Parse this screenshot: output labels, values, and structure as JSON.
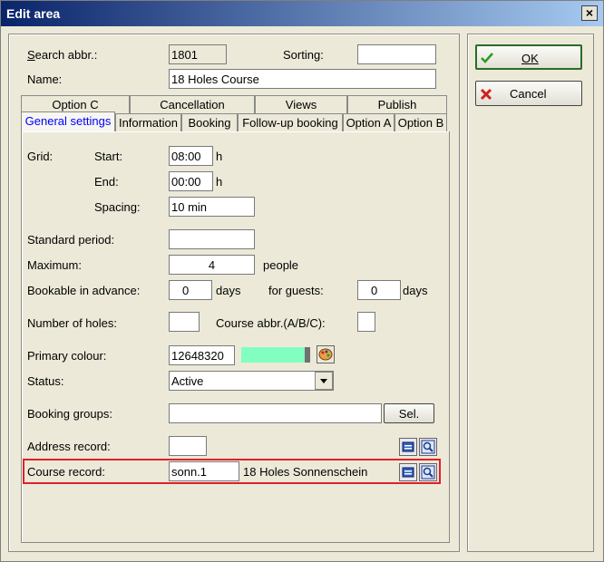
{
  "window": {
    "title": "Edit area",
    "close_glyph": "×"
  },
  "fields": {
    "search_abbr": {
      "label": "Search abbr.:",
      "value": "1801"
    },
    "sorting": {
      "label": "Sorting:",
      "value": ""
    },
    "name": {
      "label": "Name:",
      "value": "18 Holes Course"
    }
  },
  "tabs_top": [
    "Option C",
    "Cancellation",
    "Views",
    "Publish"
  ],
  "tabs_bottom": [
    "General settings",
    "Information",
    "Booking",
    "Follow-up booking",
    "Option A",
    "Option B"
  ],
  "grid": {
    "label": "Grid:",
    "start_label": "Start:",
    "start_value": "08:00",
    "start_unit": "h",
    "end_label": "End:",
    "end_value": "00:00",
    "end_unit": "h",
    "spacing_label": "Spacing:",
    "spacing_value": "10 min"
  },
  "standard_period": {
    "label": "Standard period:",
    "value": ""
  },
  "maximum": {
    "label": "Maximum:",
    "value": "4",
    "unit": "people"
  },
  "bookable": {
    "label": "Bookable in advance:",
    "value": "0",
    "unit": "days",
    "guests_label": "for guests:",
    "guests_value": "0",
    "guests_unit": "days"
  },
  "holes": {
    "label": "Number of holes:",
    "value": "",
    "course_abbr_label": "Course abbr.(A/B/C):",
    "course_abbr_value": ""
  },
  "primary_colour": {
    "label": "Primary colour:",
    "value": "12648320",
    "swatch": "#80ffc0"
  },
  "status": {
    "label": "Status:",
    "value": "Active"
  },
  "booking_groups": {
    "label": "Booking groups:",
    "value": "",
    "select_label": "Sel."
  },
  "address_record": {
    "label": "Address record:",
    "value": ""
  },
  "course_record": {
    "label": "Course record:",
    "value": "sonn.1",
    "text": "18 Holes Sonnenschein",
    "highlight": "#e0202a"
  },
  "buttons": {
    "ok": "OK",
    "cancel": "Cancel"
  }
}
